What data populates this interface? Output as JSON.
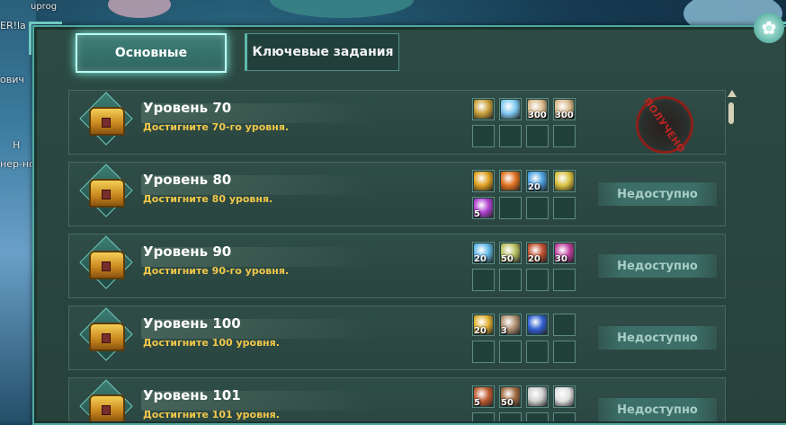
{
  "background": {
    "player_names": [
      "uprog",
      "ER!la",
      "ович",
      "Н",
      "нер-но"
    ]
  },
  "tabs": {
    "main": "Основные",
    "quests": "Ключевые задания"
  },
  "status": {
    "claimed": "ПОЛУЧЕНО",
    "unavailable": "Недоступно"
  },
  "colors": {
    "panel": "#2c4a43",
    "accent": "#7ff5e6",
    "desc_text": "#f1c74a",
    "stamp": "#b32620"
  },
  "rows": [
    {
      "title": "Уровень 70",
      "desc": "Достигните 70-го уровня.",
      "state": "claimed",
      "items": [
        {
          "icon": "potion-icon",
          "color": "#c8a03a",
          "qty": ""
        },
        {
          "icon": "crystal-icon",
          "color": "#7ec8f0",
          "qty": ""
        },
        {
          "icon": "coin-icon",
          "color": "#d9b98a",
          "qty": "300"
        },
        {
          "icon": "coin-icon",
          "color": "#d9b98a",
          "qty": "300"
        }
      ]
    },
    {
      "title": "Уровень 80",
      "desc": "Достигните 80 уровня.",
      "state": "unavailable",
      "items": [
        {
          "icon": "scroll-icon",
          "color": "#e0a020",
          "qty": ""
        },
        {
          "icon": "rune-icon",
          "color": "#e07020",
          "qty": ""
        },
        {
          "icon": "crystal-icon",
          "color": "#4aa0e0",
          "qty": "20"
        },
        {
          "icon": "parchment-icon",
          "color": "#d8c040",
          "qty": ""
        },
        {
          "icon": "orb-icon",
          "color": "#b040d0",
          "qty": "5"
        }
      ]
    },
    {
      "title": "Уровень 90",
      "desc": "Достигните 90-го уровня.",
      "state": "unavailable",
      "items": [
        {
          "icon": "crystal-icon",
          "color": "#60b8e8",
          "qty": "20"
        },
        {
          "icon": "scroll-icon",
          "color": "#b8c060",
          "qty": "50"
        },
        {
          "icon": "potion-icon",
          "color": "#c05030",
          "qty": "20"
        },
        {
          "icon": "gem-icon",
          "color": "#c040a0",
          "qty": "30"
        }
      ]
    },
    {
      "title": "Уровень 100",
      "desc": "Достигните 100 уровня.",
      "state": "unavailable",
      "items": [
        {
          "icon": "orb-icon",
          "color": "#e0b030",
          "qty": "20"
        },
        {
          "icon": "key-icon",
          "color": "#b09070",
          "qty": "3"
        },
        {
          "icon": "box-icon",
          "color": "#3060d0",
          "qty": ""
        }
      ]
    },
    {
      "title": "Уровень 101",
      "desc": "Достигните 101 уровня.",
      "state": "unavailable",
      "items": [
        {
          "icon": "potion-icon",
          "color": "#c05a30",
          "qty": "5"
        },
        {
          "icon": "scroll-icon",
          "color": "#a06a40",
          "qty": "50"
        },
        {
          "icon": "coin-icon",
          "color": "#d0d0d0",
          "qty": ""
        },
        {
          "icon": "coin-icon",
          "color": "#e0e0e0",
          "qty": ""
        }
      ]
    }
  ]
}
